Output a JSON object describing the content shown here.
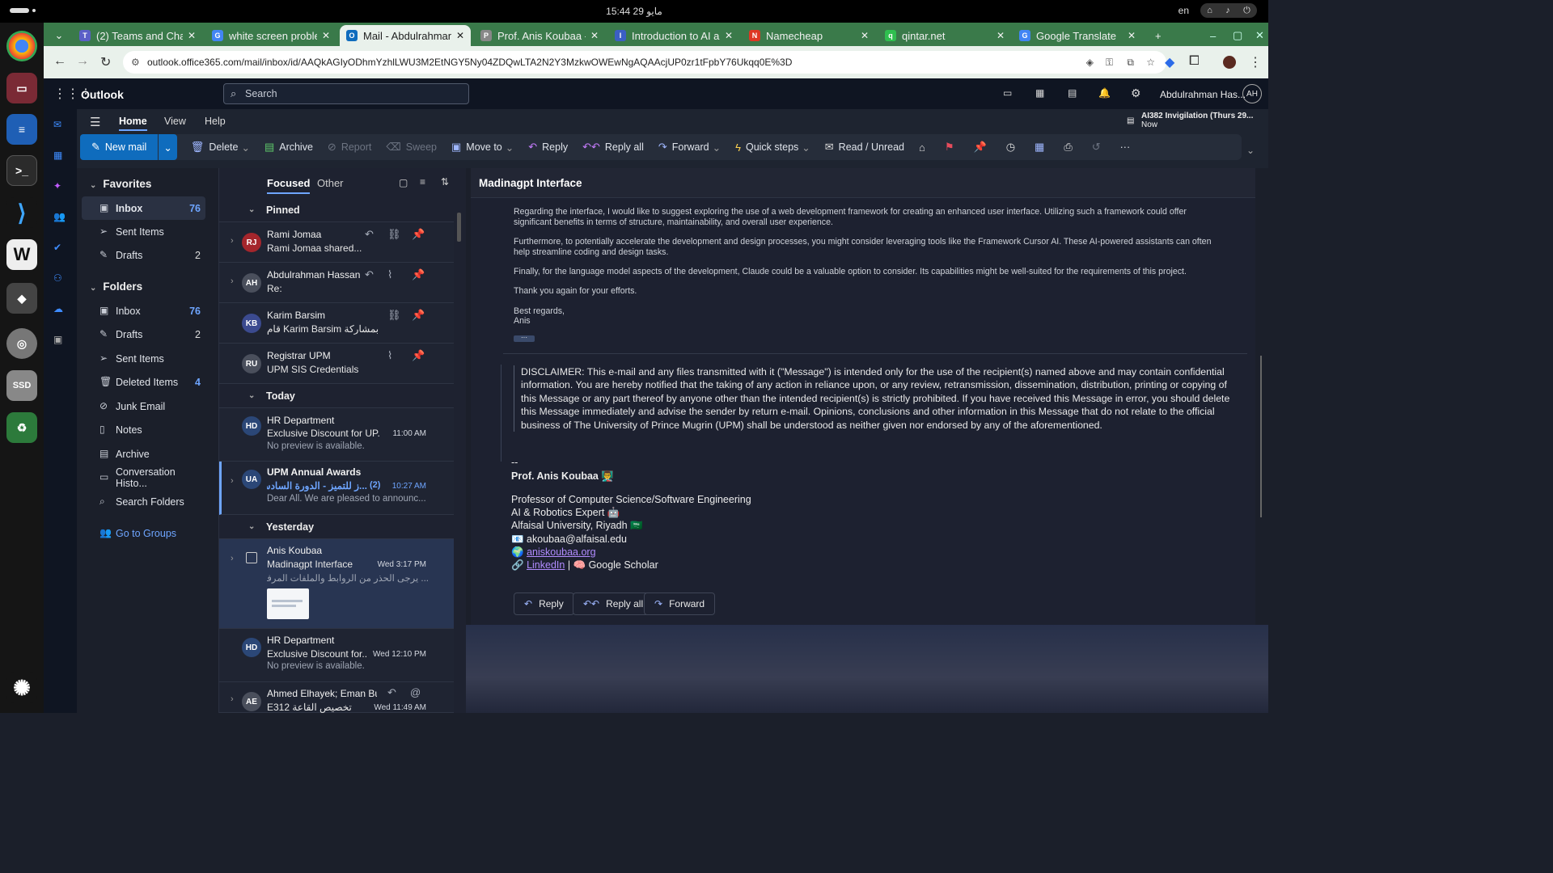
{
  "system": {
    "clock": "15:44 مايو 29",
    "lang": "en"
  },
  "dock": [
    "chrome-icon",
    "files-icon",
    "writer-icon",
    "terminal-icon",
    "vscode-icon",
    "wps-icon",
    "inkscape-icon",
    "disc-icon",
    "ssd-icon",
    "trash-icon",
    "ubuntu-icon"
  ],
  "browser": {
    "tabs": [
      {
        "title": "(2) Teams and Chan",
        "fav": "T",
        "color": "#5b5fc7"
      },
      {
        "title": "white screen proble",
        "fav": "G",
        "color": "#4285f4"
      },
      {
        "title": "Mail - Abdulrahman",
        "fav": "O",
        "color": "#0f6cbd"
      },
      {
        "title": "Prof. Anis Koubaa -",
        "fav": "P",
        "color": "#888888"
      },
      {
        "title": "Introduction to AI a",
        "fav": "I",
        "color": "#3b5fc4"
      },
      {
        "title": "Namecheap",
        "fav": "N",
        "color": "#de3723"
      },
      {
        "title": "qintar.net",
        "fav": "q",
        "color": "#2fbf4f"
      },
      {
        "title": "Google Translate",
        "fav": "G",
        "color": "#4285f4"
      }
    ],
    "url": "outlook.office365.com/mail/inbox/id/AAQkAGIyODhmYzhlLWU3M2EtNGY5Ny04ZDQwLTA2N2Y3MzkwOWEwNgAQAAcjUP0zr1tFpbY76Ukqq0E%3D"
  },
  "outlook": {
    "app_name": "Outlook",
    "search_placeholder": "Search",
    "user_name": "Abdulrahman Has...",
    "user_initials": "AH",
    "ribbon_tabs": [
      "Home",
      "View",
      "Help"
    ],
    "reminder": {
      "title": "AI382 Invigilation (Thurs 29...",
      "time": "Now"
    },
    "commands": {
      "new_mail": "New mail",
      "delete": "Delete",
      "archive": "Archive",
      "report": "Report",
      "sweep": "Sweep",
      "move_to": "Move to",
      "reply": "Reply",
      "reply_all": "Reply all",
      "forward": "Forward",
      "quick_steps": "Quick steps",
      "read_unread": "Read / Unread"
    }
  },
  "folders": {
    "favorites_label": "Favorites",
    "folders_label": "Folders",
    "favorites": [
      {
        "label": "Inbox",
        "count": "76",
        "icon": "inbox-icon"
      },
      {
        "label": "Sent Items",
        "count": "",
        "icon": "send-icon"
      },
      {
        "label": "Drafts",
        "count": "2",
        "icon": "pencil-icon"
      }
    ],
    "items": [
      {
        "label": "Inbox",
        "count": "76",
        "icon": "inbox-icon"
      },
      {
        "label": "Drafts",
        "count": "2",
        "icon": "pencil-icon"
      },
      {
        "label": "Sent Items",
        "count": "",
        "icon": "send-icon"
      },
      {
        "label": "Deleted Items",
        "count": "4",
        "icon": "trash-icon"
      },
      {
        "label": "Junk Email",
        "count": "",
        "icon": "junk-icon"
      },
      {
        "label": "Notes",
        "count": "",
        "icon": "note-icon"
      },
      {
        "label": "Archive",
        "count": "",
        "icon": "archive-icon"
      },
      {
        "label": "Conversation Histo...",
        "count": "",
        "icon": "folder-icon"
      },
      {
        "label": "Search Folders",
        "count": "",
        "icon": "search-folder-icon"
      }
    ],
    "groups_link": "Go to Groups"
  },
  "list": {
    "tabs": {
      "focused": "Focused",
      "other": "Other"
    },
    "groups": {
      "pinned": "Pinned",
      "today": "Today",
      "yesterday": "Yesterday"
    },
    "messages": [
      {
        "initials": "RJ",
        "color": "#a4262c",
        "sender": "Rami Jomaa",
        "subject": "Rami Jomaa shared...",
        "preview": "",
        "time": ""
      },
      {
        "initials": "AH",
        "color": "#4a4f5c",
        "sender": "Abdulrahman Hassan",
        "subject": "Re:",
        "preview": "",
        "time": ""
      },
      {
        "initials": "KB",
        "color": "#3b4a8f",
        "sender": "Karim Barsim",
        "subject": "قام Karim Barsim بمشاركة ...",
        "preview": "",
        "time": ""
      },
      {
        "initials": "RU",
        "color": "#4a4f5c",
        "sender": "Registrar UPM",
        "subject": "UPM SIS Credentials",
        "preview": "",
        "time": ""
      },
      {
        "initials": "HD",
        "color": "#2b4777",
        "sender": "HR Department",
        "subject": "Exclusive Discount for UP...",
        "preview": "No preview is available.",
        "time": "11:00 AM"
      },
      {
        "initials": "UA",
        "color": "#2b4777",
        "sender": "UPM Annual Awards",
        "subject": "...ز للتميز - الدورة السادسة",
        "count": "(2)",
        "preview": "Dear All. We are pleased to announc...",
        "time": "10:27 AM"
      },
      {
        "initials": "",
        "color": "#283552",
        "sender": "Anis Koubaa",
        "subject": "Madinagpt Interface",
        "preview": "... يرجى الحذر من الروابط والملفات المرفقة",
        "time": "Wed 3:17 PM"
      },
      {
        "initials": "HD",
        "color": "#2b4777",
        "sender": "HR Department",
        "subject": "Exclusive Discount for...",
        "preview": "No preview is available.",
        "time": "Wed 12:10 PM"
      },
      {
        "initials": "AE",
        "color": "#4a4f5c",
        "sender": "Ahmed Elhayek; Eman Bu...",
        "subject": "E312 تخصيص القاعة",
        "preview": "",
        "time": "Wed 11:49 AM"
      }
    ]
  },
  "reading": {
    "title": "Madinagpt Interface",
    "paragraphs": [
      "Regarding the interface, I would like to suggest exploring the use of a web development framework for creating an enhanced user interface. Utilizing such a framework could offer significant benefits in terms of structure, maintainability, and overall user experience.",
      "Furthermore, to potentially accelerate the development and design processes, you might consider leveraging tools like the Framework Cursor AI. These AI-powered assistants can often help streamline coding and design tasks.",
      "Finally, for the language model aspects of the development, Claude could be a valuable option to consider. Its capabilities might be well-suited for the requirements of this project.",
      "Thank you again for your efforts.",
      "Best regards,",
      "Anis"
    ],
    "disclaimer": "DISCLAIMER: This e-mail and any files transmitted with it (\"Message\") is intended only for the use of the recipient(s) named above and may contain confidential information. You are hereby notified that the taking of any action in reliance upon, or any review, retransmission, dissemination, distribution, printing or copying of this Message or any part thereof by anyone other than the intended recipient(s) is strictly prohibited. If you have received this Message in error, you should delete this Message immediately and advise the sender by return e-mail. Opinions, conclusions and other information in this Message that do not relate to the official business of The University of Prince Mugrin (UPM) shall be understood as neither given nor endorsed by any of the aforementioned.",
    "signature": {
      "dashes": "--",
      "name": "Prof. Anis Koubaa 👨‍🏫",
      "role": "Professor of Computer Science/Software Engineering",
      "expert": "AI & Robotics Expert 🤖",
      "affiliation": "Alfaisal University, Riyadh 🇸🇦",
      "email": "📧 akoubaa@alfaisal.edu",
      "web_prefix": "🌍",
      "web": "aniskoubaa.org",
      "link_prefix": "🔗",
      "linkedin": "LinkedIn",
      "scholar": "| 🧠 Google Scholar"
    },
    "actions": {
      "reply": "Reply",
      "reply_all": "Reply all",
      "forward": "Forward"
    }
  }
}
